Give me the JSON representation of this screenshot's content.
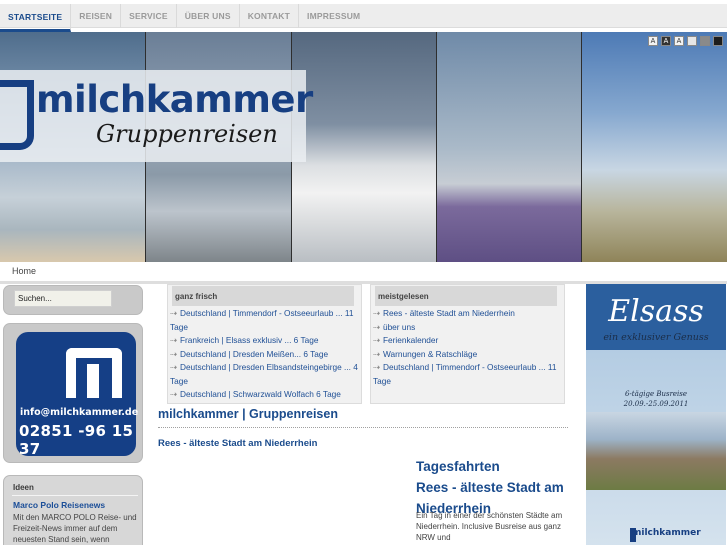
{
  "nav": {
    "items": [
      {
        "label": "STARTSEITE",
        "active": true
      },
      {
        "label": "REISEN",
        "active": false
      },
      {
        "label": "SERVICE",
        "active": false
      },
      {
        "label": "ÜBER UNS",
        "active": false
      },
      {
        "label": "KONTAKT",
        "active": false
      },
      {
        "label": "IMPRESSUM",
        "active": false
      }
    ]
  },
  "header": {
    "logo_word": "milchkammer",
    "logo_sub": "Gruppenreisen",
    "fontsize_labels": [
      "A",
      "A",
      "A"
    ]
  },
  "breadcrumb": "Home",
  "search": {
    "value": "Suchen..."
  },
  "contact": {
    "email": "info@milchkammer.de",
    "phone": "02851 -96 15 37"
  },
  "ideen": {
    "title": "Ideen",
    "link": "Marco Polo Reisenews",
    "text": "Mit den MARCO POLO Reise- und Freizeit-News immer auf dem neuesten Stand sein, wenn"
  },
  "frisch": {
    "title": "ganz frisch",
    "items": [
      "Deutschland | Timmendorf - Ostseeurlaub ... 11 Tage",
      "Frankreich | Elsass exklusiv ... 6 Tage",
      "Deutschland | Dresden Meißen... 6 Tage",
      "Deutschland | Dresden Elbsandsteingebirge ... 4 Tage",
      "Deutschland | Schwarzwald Wolfach 6 Tage"
    ]
  },
  "gelesen": {
    "title": "meistgelesen",
    "items": [
      "Rees - älteste Stadt am Niederrhein",
      "über uns",
      "Ferienkalender",
      "Warnungen & Ratschläge",
      "Deutschland | Timmendorf - Ostseeurlaub ... 11 Tage"
    ]
  },
  "main": {
    "title": "milchkammer | Gruppenreisen",
    "article_title": "Rees - älteste Stadt am Niederrhein",
    "tages_lines": [
      "Tagesfahrten",
      "Rees - älteste Stadt am",
      "Niederrhein"
    ],
    "tages_text": "Ein Tag in einer der schönsten Städte am Niederrhein. Inclusive Busreise aus ganz NRW und"
  },
  "ad": {
    "title": "Elsass",
    "subtitle": "ein exklusiver Genuss",
    "date_line1": "6-tägige Busreise",
    "date_line2": "20.09.-25.09.2011",
    "logo": "milchkammer"
  },
  "arrow_glyph": "⇢"
}
